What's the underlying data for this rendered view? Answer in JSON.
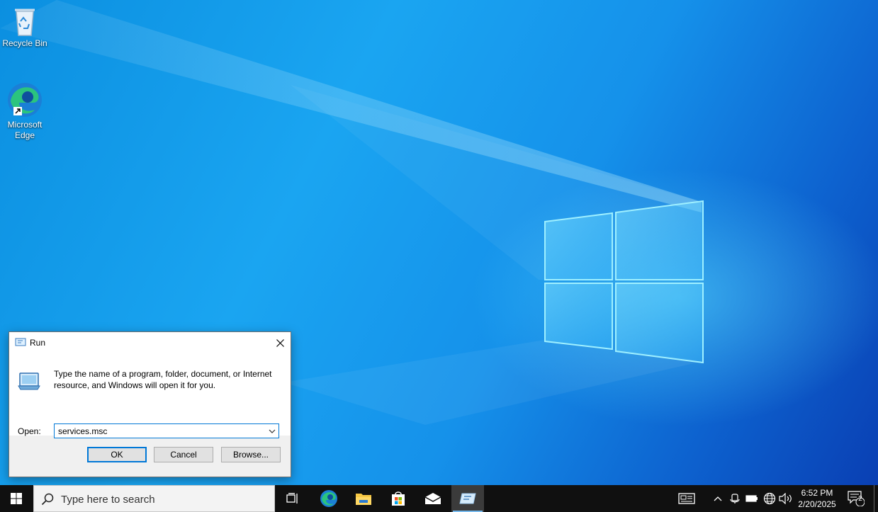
{
  "desktop": {
    "icons": [
      {
        "label": "Recycle Bin",
        "icon": "recycle-bin-icon"
      },
      {
        "label": "Microsoft Edge",
        "icon": "edge-icon"
      }
    ]
  },
  "run_dialog": {
    "title": "Run",
    "description": "Type the name of a program, folder, document, or Internet resource, and Windows will open it for you.",
    "open_label": "Open:",
    "open_value": "services.msc",
    "ok_label": "OK",
    "cancel_label": "Cancel",
    "browse_label": "Browse..."
  },
  "taskbar": {
    "search_placeholder": "Type here to search",
    "pinned": [
      "task-view-icon",
      "edge-icon",
      "file-explorer-icon",
      "store-icon",
      "mail-icon",
      "run-icon"
    ],
    "clock_time": "6:52 PM",
    "clock_date": "2/20/2025",
    "notification_count": "2"
  },
  "colors": {
    "accent": "#0078d7",
    "taskbar": "#101010",
    "active_indicator": "#76b9ed"
  }
}
